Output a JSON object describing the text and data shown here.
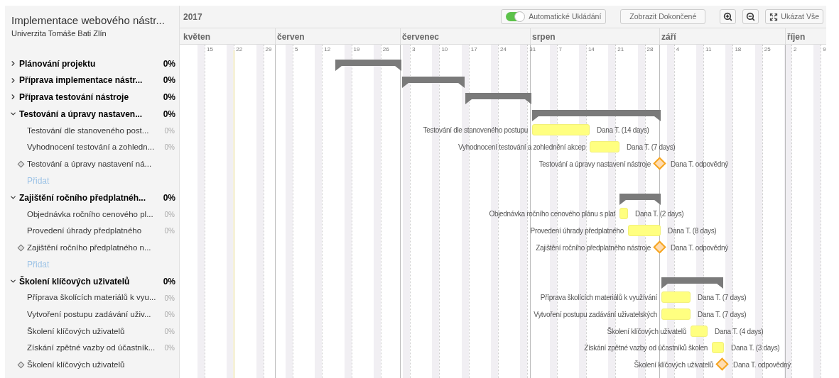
{
  "project": {
    "title": "Implementace webového nástr...",
    "subtitle": "Univerzita Tomáše Bati Zlín"
  },
  "toolbar": {
    "year": "2017",
    "autosave": {
      "label": "Automatické Ukládání",
      "on": true
    },
    "show_completed": "Zobrazit Dokončené",
    "show_all": "Ukázat Vše"
  },
  "timeline": {
    "months": [
      "květen",
      "červen",
      "červenec",
      "srpen",
      "září",
      "říjen"
    ],
    "days": [
      "15",
      "22",
      "29",
      "5",
      "12",
      "19",
      "26",
      "3",
      "10",
      "17",
      "24",
      "31",
      "7",
      "14",
      "21",
      "28",
      "4",
      "11",
      "18",
      "25",
      "2",
      "9"
    ]
  },
  "groups": [
    {
      "name": "Plánování projektu",
      "percent": "0%",
      "expanded": false
    },
    {
      "name": "Příprava implementace nástr...",
      "percent": "0%",
      "expanded": false
    },
    {
      "name": "Příprava testování nástroje",
      "percent": "0%",
      "expanded": false
    },
    {
      "name": "Testování a úpravy nastaven...",
      "percent": "0%",
      "expanded": true,
      "children": [
        {
          "kind": "task",
          "name": "Testování dle stanoveného post...",
          "percent": "0%",
          "bar_label": "Testování dle stanoveného postupu",
          "bar_note": "Dana T. (14 days)"
        },
        {
          "kind": "task",
          "name": "Vyhodnocení testování a zohledn...",
          "percent": "0%",
          "bar_label": "Vyhodnocení testování a zohlednění akcep",
          "bar_note": "Dana T. (7 days)"
        },
        {
          "kind": "milestone",
          "name": "Testování a úpravy nastavení ná...",
          "bar_label": "Testování a úpravy nastavení nástroje",
          "bar_note": "Dana T. odpovědný"
        },
        {
          "kind": "add",
          "name": "Přidat"
        }
      ]
    },
    {
      "name": "Zajištění ročního předplatnéh...",
      "percent": "0%",
      "expanded": true,
      "children": [
        {
          "kind": "task",
          "name": "Objednávka ročního cenového pl...",
          "percent": "0%",
          "bar_label": "Objednávka ročního cenového plánu s plat",
          "bar_note": "Dana T. (2 days)"
        },
        {
          "kind": "task",
          "name": "Provedení úhrady předplatného",
          "percent": "0%",
          "bar_label": "Provedení úhrady předplatného",
          "bar_note": "Dana T. (8 days)"
        },
        {
          "kind": "milestone",
          "name": "Zajištění ročního předplatného n...",
          "bar_label": "Zajištění ročního předplatného nástroje",
          "bar_note": "Dana T. odpovědný"
        },
        {
          "kind": "add",
          "name": "Přidat"
        }
      ]
    },
    {
      "name": "Školení klíčových uživatelů",
      "percent": "0%",
      "expanded": true,
      "children": [
        {
          "kind": "task",
          "name": "Příprava školících materiálů k vyu...",
          "percent": "0%",
          "bar_label": "Příprava školících materiálů k využívání",
          "bar_note": "Dana T. (7 days)"
        },
        {
          "kind": "task",
          "name": "Vytvoření postupu zadávání uživ...",
          "percent": "0%",
          "bar_label": "Vytvoření postupu zadávání uživatelských",
          "bar_note": "Dana T. (7 days)"
        },
        {
          "kind": "task",
          "name": "Školení klíčových uživatelů",
          "percent": "0%",
          "bar_label": "Školení klíčových uživatelů",
          "bar_note": "Dana T. (4 days)"
        },
        {
          "kind": "task",
          "name": "Získání zpětné vazby od účastník...",
          "percent": "0%",
          "bar_label": "Získání zpětné vazby od účastníků školen",
          "bar_note": "Dana T. (3 days)"
        },
        {
          "kind": "milestone",
          "name": "Školení klíčových uživatelů",
          "bar_label": "Školení klíčových uživatelů",
          "bar_note": "Dana T. odpovědný"
        }
      ]
    }
  ]
}
